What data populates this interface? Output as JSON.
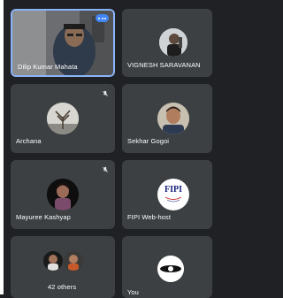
{
  "participants": [
    {
      "name": "Dilip Kumar Mahata",
      "active": true,
      "has_menu": true
    },
    {
      "name": "VIGNESH SARAVANAN",
      "muted": false
    },
    {
      "name": "Archana",
      "muted": true
    },
    {
      "name": "Sekhar Gogoi",
      "muted": false
    },
    {
      "name": "Mayuree Kashyap",
      "muted": true
    },
    {
      "name": "FIPI Web-host",
      "muted": false,
      "logo_text": "FIPI"
    },
    {
      "name": "42 others"
    },
    {
      "name": "You"
    }
  ],
  "icons": {
    "menu": "more-options-icon",
    "muted": "mic-off-icon"
  },
  "colors": {
    "background": "#202124",
    "tile": "#3c4043",
    "active_border": "#8ab4f8",
    "menu_button": "#4285f4"
  }
}
